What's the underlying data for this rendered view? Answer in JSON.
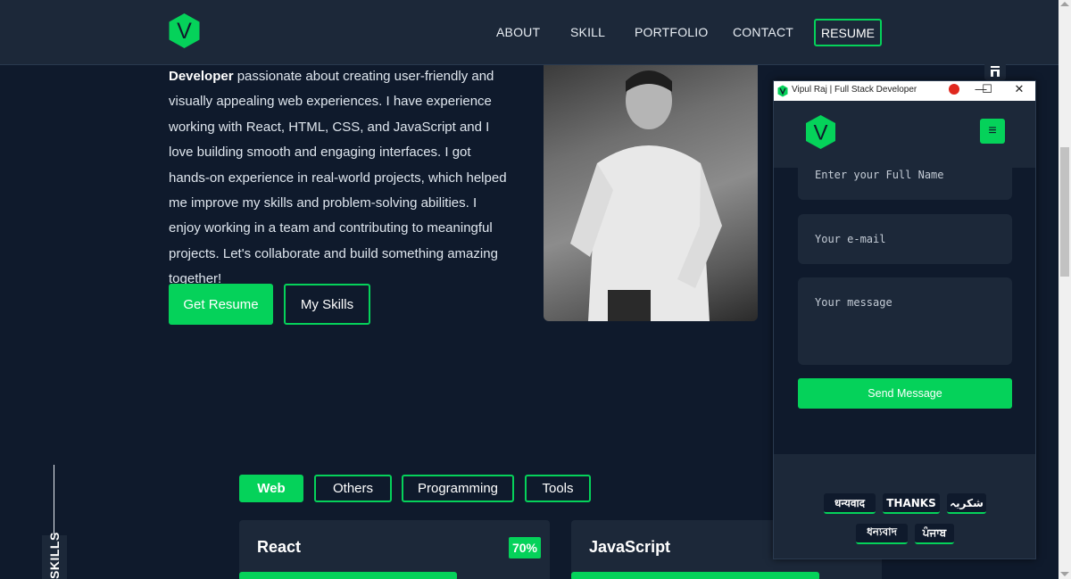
{
  "nav": {
    "logo_letter": "V",
    "items": [
      "ABOUT",
      "SKILL",
      "PORTFOLIO",
      "CONTACT"
    ],
    "resume_label": "RESUME"
  },
  "about": {
    "bold_lead": "Developer",
    "text": " passionate about creating user-friendly and visually appealing web experiences. I have experience working with React, HTML, CSS, and JavaScript and I love building smooth and engaging interfaces. I got hands-on experience in real-world projects, which helped me improve my skills and problem-solving abilities. I enjoy working in a team and contributing to meaningful projects. Let's collaborate and build something amazing together!",
    "btn_resume": "Get Resume",
    "btn_skills": "My Skills"
  },
  "skills": {
    "section_label": "SKILLS",
    "tabs": [
      "Web",
      "Others",
      "Programming",
      "Tools"
    ],
    "active_tab": "Web",
    "cards": [
      {
        "title": "React",
        "percent_label": "70%",
        "level": 0.7
      },
      {
        "title": "JavaScript",
        "percent_label": "",
        "level": 0.8
      }
    ]
  },
  "popup": {
    "window_title": "Vipul Raj | Full Stack Developer",
    "minimize": "—",
    "maximize": "☐",
    "close": "✕",
    "logo_letter": "V",
    "menu_icon": "≡",
    "name_placeholder": "Enter your Full Name",
    "email_placeholder": "Your e-mail",
    "message_placeholder": "Your message",
    "send_label": "Send Message",
    "thanks": [
      "धन्यवाद",
      "THANKS",
      "شکریہ",
      "ধন্যবাদ",
      "ਪੰਜਾਬ"
    ]
  },
  "colors": {
    "accent": "#05d25a",
    "background": "#0f1a2c",
    "panel": "#1c2839"
  }
}
